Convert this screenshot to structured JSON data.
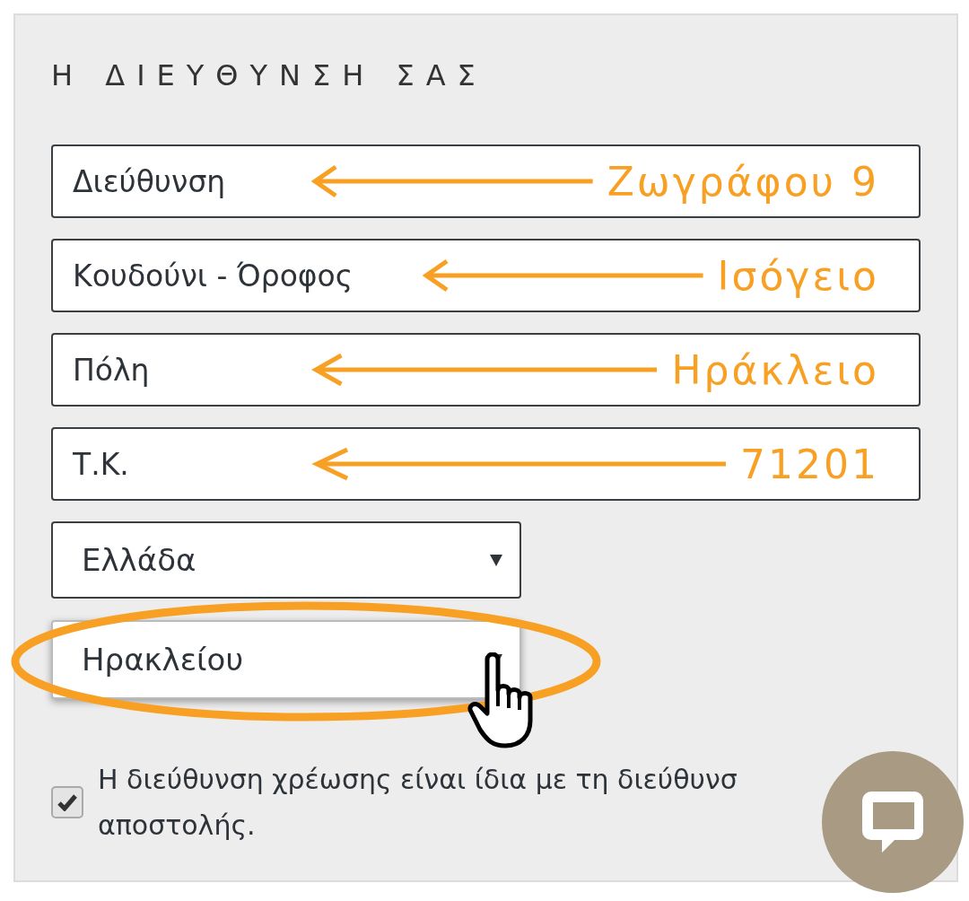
{
  "section": {
    "title": "Η ΔΙΕΥΘΥΝΣΗ ΣΑΣ"
  },
  "fields": [
    {
      "placeholder": "Διεύθυνση",
      "annotation": "Ζωγράφου 9"
    },
    {
      "placeholder": "Κουδούνι - Όροφος",
      "annotation": "Ισόγειο"
    },
    {
      "placeholder": "Πόλη",
      "annotation": "Ηράκλειο"
    },
    {
      "placeholder": "Τ.Κ.",
      "annotation": "71201"
    }
  ],
  "selects": [
    {
      "value": "Ελλάδα",
      "highlighted": false
    },
    {
      "value": "Ηρακλείου",
      "highlighted": true
    }
  ],
  "billing_same": {
    "checked": true,
    "lines": [
      "Η διεύθυνση χρέωσης είναι ίδια με τη διεύθυνσ",
      "αποστολής."
    ]
  }
}
